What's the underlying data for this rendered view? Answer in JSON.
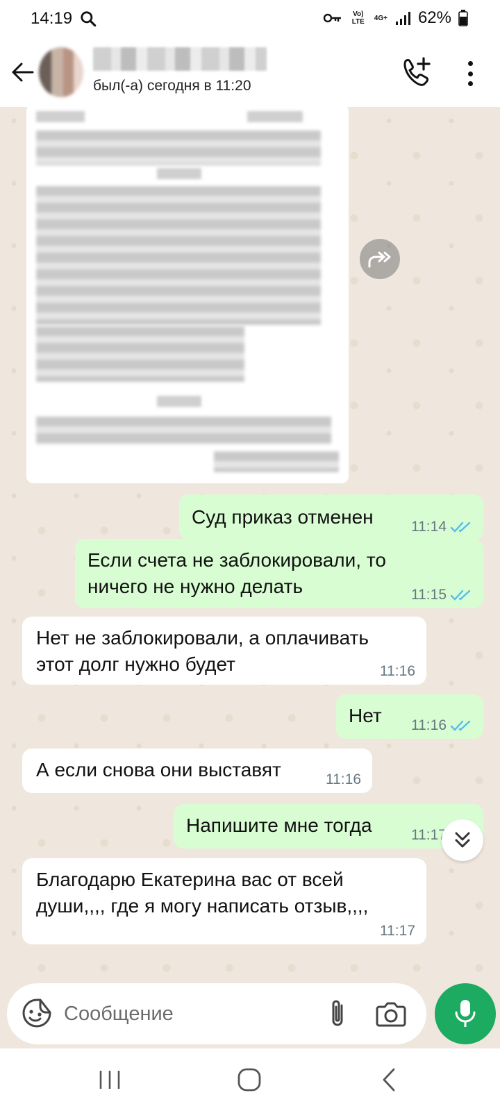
{
  "status_bar": {
    "time": "14:19",
    "lte_label": "Vo) LTE",
    "network_label": "4G+",
    "battery": "62%"
  },
  "header": {
    "status": "был(-а) сегодня в 11:20"
  },
  "messages": [
    {
      "direction": "out",
      "text": "Суд приказ отменен",
      "time": "11:14",
      "read": true
    },
    {
      "direction": "out",
      "text": "Если счета не заблокировали, то ничего не нужно делать",
      "time": "11:15",
      "read": true
    },
    {
      "direction": "in",
      "text": "Нет не заблокировали, а оплачивать этот долг нужно будет",
      "time": "11:16"
    },
    {
      "direction": "out",
      "text": "Нет",
      "time": "11:16",
      "read": true
    },
    {
      "direction": "in",
      "text": "А если снова они выставят",
      "time": "11:16"
    },
    {
      "direction": "out",
      "text": "Напишите мне тогда",
      "time": "11:17",
      "read": true
    },
    {
      "direction": "in",
      "text": "Благодарю Екатерина вас от всей души,,,, где я могу написать отзыв,,,,",
      "time": "11:17"
    }
  ],
  "composer": {
    "placeholder": "Сообщение"
  },
  "colors": {
    "outgoing_bubble": "#d9fdd3",
    "incoming_bubble": "#ffffff",
    "chat_background": "#efe7dd",
    "read_tick": "#53bdeb",
    "mic_button": "#1daa61"
  },
  "icons": [
    "search-icon",
    "key-icon",
    "signal-icon",
    "battery-icon",
    "back-arrow-icon",
    "add-call-icon",
    "more-vert-icon",
    "forward-icon",
    "double-check-icon",
    "chevron-double-down-icon",
    "sticker-icon",
    "attach-icon",
    "camera-icon",
    "mic-icon",
    "recent-apps-icon",
    "home-icon",
    "nav-back-icon"
  ]
}
